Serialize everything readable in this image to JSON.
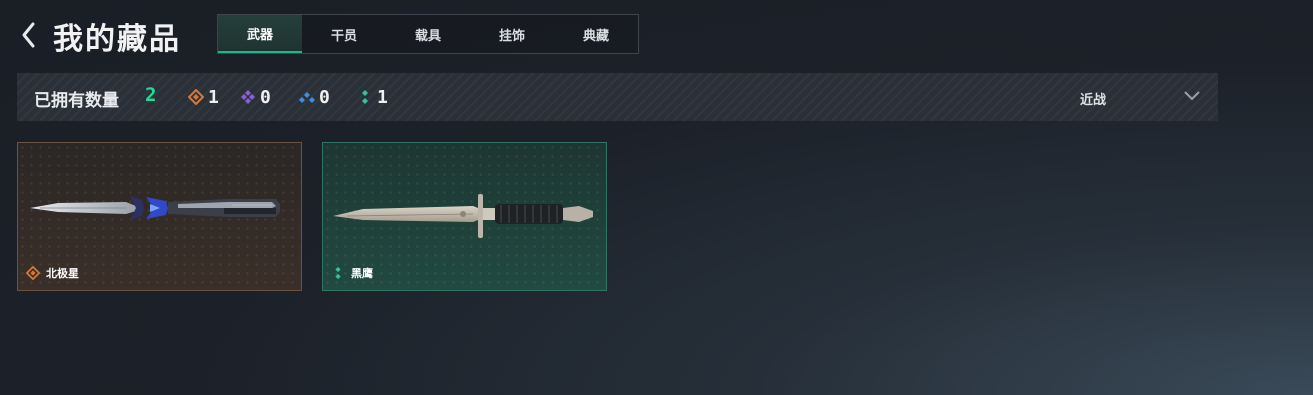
{
  "header": {
    "title": "我的藏品",
    "tabs": [
      {
        "label": "武器",
        "active": true
      },
      {
        "label": "干员",
        "active": false
      },
      {
        "label": "载具",
        "active": false
      },
      {
        "label": "挂饰",
        "active": false
      },
      {
        "label": "典藏",
        "active": false
      }
    ]
  },
  "summary": {
    "owned_label": "已拥有数量",
    "owned_count": "2",
    "rarity_counts": [
      {
        "icon": "orange-diamond-icon",
        "count": "1",
        "color": "#d7773a"
      },
      {
        "icon": "purple-diamond-icon",
        "count": "0",
        "color": "#8a5fd6"
      },
      {
        "icon": "blue-diamond-icon",
        "count": "0",
        "color": "#3e8ee0"
      },
      {
        "icon": "green-diamond-icon",
        "count": "1",
        "color": "#2fc79a"
      }
    ],
    "sort": {
      "selected": "近战"
    }
  },
  "items": [
    {
      "name": "北极星",
      "rarity_color": "#d7773a",
      "rarity_icon": "orange-diamond-icon"
    },
    {
      "name": "黑鹰",
      "rarity_color": "#2fc79a",
      "rarity_icon": "green-diamond-icon"
    }
  ],
  "colors": {
    "accent": "#27d995",
    "tab_active": "#1fb58a"
  }
}
